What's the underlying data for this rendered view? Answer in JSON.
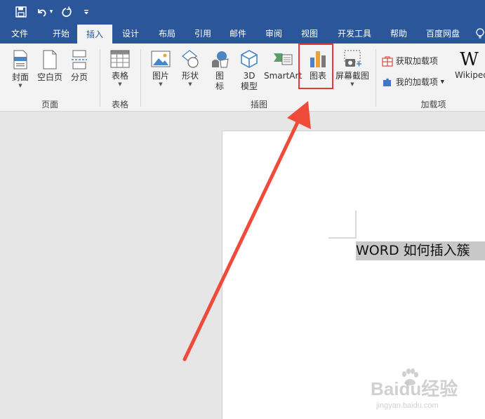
{
  "quick_access": {
    "save_icon": "save-icon",
    "undo_icon": "undo-icon",
    "undo_dropdown": "▾",
    "redo_icon": "redo-icon",
    "customize_icon": "customize-qat-icon"
  },
  "tabs": [
    "文件",
    "开始",
    "插入",
    "设计",
    "布局",
    "引用",
    "邮件",
    "审阅",
    "视图",
    "开发工具",
    "帮助",
    "百度网盘"
  ],
  "active_tab": "插入",
  "ribbon": {
    "pages_group": {
      "label": "页面",
      "cover": "封面",
      "blank_page": "空白页",
      "page_break": "分页"
    },
    "tables_group": {
      "label": "表格",
      "table": "表格"
    },
    "illustrations_group": {
      "label": "插图",
      "pictures": "图片",
      "shapes": "形状",
      "icons_1": "图",
      "icons_2": "标",
      "model_3d_1": "3D",
      "model_3d_2": "模型",
      "smartart": "SmartArt",
      "chart": "图表",
      "screenshot": "屏幕截图"
    },
    "addins_group": {
      "label": "加载项",
      "get_addins": "获取加载项",
      "my_addins": "我的加载项",
      "wikipedia_logo": "W",
      "wikipedia": "Wikiped"
    }
  },
  "document": {
    "selected_text": "WORD 如何插入簇"
  },
  "watermark": {
    "brand": "Baidu经验",
    "url": "jingyan.baidu.com"
  },
  "annotation": {
    "highlight_color": "#e53935",
    "arrow_color": "#f04a3a"
  },
  "colors": {
    "title_bar": "#2b579a",
    "ribbon": "#f3f3f3",
    "workspace": "#e6e6e6"
  }
}
